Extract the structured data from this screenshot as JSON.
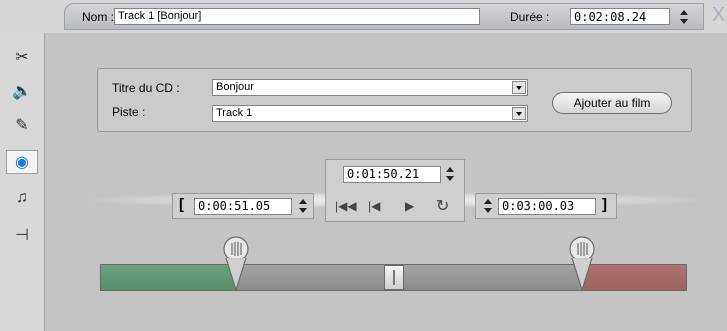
{
  "toolbar": {
    "name_label": "Nom :",
    "name_value": "Track 1 [Bonjour]",
    "duration_label": "Durée :",
    "duration_value": "0:02:08.24",
    "close_glyph": "X"
  },
  "sidebar": {
    "tabs": [
      {
        "icon": "video-edit-icon",
        "glyph": "✂"
      },
      {
        "icon": "audio-speaker-icon",
        "glyph": "🔈"
      },
      {
        "icon": "pen-tool-icon",
        "glyph": "✎"
      },
      {
        "icon": "cd-disc-icon",
        "glyph": "◉",
        "active": true
      },
      {
        "icon": "music-note-icon",
        "glyph": "♫"
      },
      {
        "icon": "plug-icon",
        "glyph": "⊣"
      }
    ]
  },
  "cd_panel": {
    "title_label": "Titre du CD :",
    "title_value": "Bonjour",
    "track_label": "Piste :",
    "track_value": "Track 1",
    "add_button": "Ajouter au film"
  },
  "transport": {
    "current_time": "0:01:50.21",
    "in_time": "0:00:51.05",
    "out_time": "0:03:00.03",
    "in_bracket": "[",
    "out_bracket": "]"
  },
  "slider": {
    "in_fraction": 0.231,
    "out_fraction": 0.822,
    "playhead_fraction": 0.5,
    "colors": {
      "in": "#5a8f6d",
      "mid": "#929292",
      "out": "#9c6262"
    }
  }
}
